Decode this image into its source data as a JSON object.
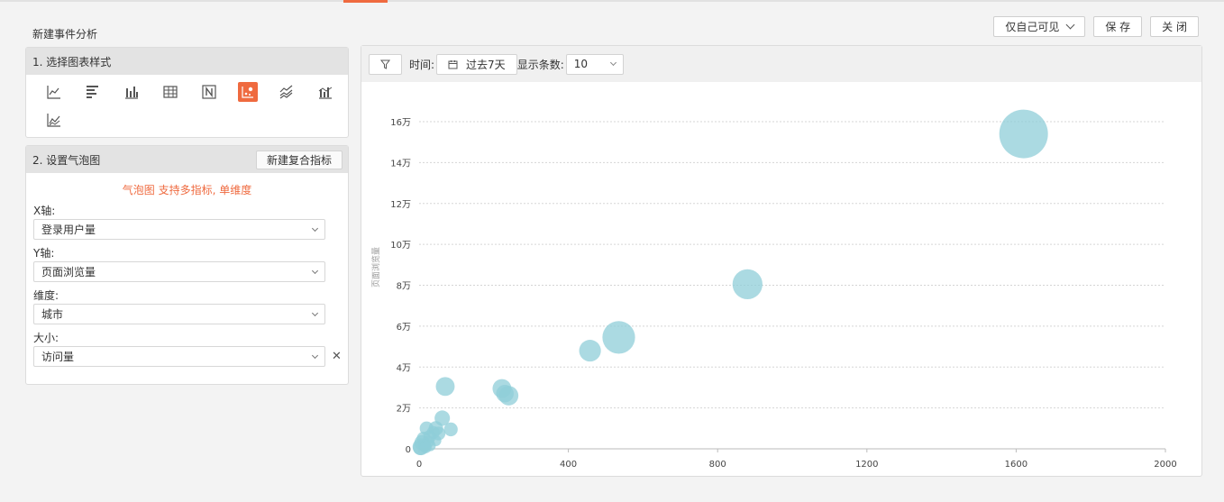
{
  "page": {
    "title": "新建事件分析"
  },
  "top_buttons": {
    "visibility": "仅自己可见",
    "save": "保 存",
    "close": "关 闭"
  },
  "accent_color": "#ef6a3f",
  "section1": {
    "title": "1. 选择图表样式",
    "icons": [
      "line-chart-icon",
      "horizontal-bar-icon",
      "bar-chart-icon",
      "table-icon",
      "number-icon",
      "bubble-chart-icon",
      "stacked-line-icon",
      "stacked-bar-icon",
      "area-line-icon"
    ],
    "active_icon": "bubble-chart-icon"
  },
  "section2": {
    "title": "2. 设置气泡图",
    "new_metric_button": "新建复合指标",
    "note": "气泡图 支持多指标, 单维度",
    "fields": [
      {
        "label": "X轴:",
        "value": "登录用户量"
      },
      {
        "label": "Y轴:",
        "value": "页面浏览量"
      },
      {
        "label": "维度:",
        "value": "城市"
      },
      {
        "label": "大小:",
        "value": "访问量"
      }
    ]
  },
  "toolbar": {
    "time_label": "时间:",
    "time_value": "过去7天",
    "count_label": "显示条数:",
    "count_value": "10"
  },
  "chart_data": {
    "type": "scatter",
    "ylabel": "页面浏览量",
    "x_ticks": [
      "0",
      "400",
      "800",
      "1200",
      "1600",
      "2000"
    ],
    "y_ticks": [
      "0",
      "2万",
      "4万",
      "6万",
      "8万",
      "10万",
      "12万",
      "14万",
      "16万"
    ],
    "xlim": [
      0,
      2000
    ],
    "ylim": [
      0,
      160000
    ],
    "bubble_color": "#8fcdd8",
    "points": [
      {
        "x": 1620,
        "y": 154000,
        "size": 100
      },
      {
        "x": 880,
        "y": 80500,
        "size": 38
      },
      {
        "x": 535,
        "y": 54500,
        "size": 45
      },
      {
        "x": 458,
        "y": 48000,
        "size": 20
      },
      {
        "x": 70,
        "y": 30500,
        "size": 15
      },
      {
        "x": 222,
        "y": 29500,
        "size": 15
      },
      {
        "x": 240,
        "y": 26000,
        "size": 16
      },
      {
        "x": 230,
        "y": 27000,
        "size": 13
      },
      {
        "x": 62,
        "y": 15000,
        "size": 10
      },
      {
        "x": 85,
        "y": 9500,
        "size": 8
      },
      {
        "x": 45,
        "y": 10000,
        "size": 9
      },
      {
        "x": 20,
        "y": 10000,
        "size": 8
      },
      {
        "x": 52,
        "y": 7500,
        "size": 8
      },
      {
        "x": 38,
        "y": 8000,
        "size": 7
      },
      {
        "x": 28,
        "y": 6000,
        "size": 7
      },
      {
        "x": 12,
        "y": 5000,
        "size": 8
      },
      {
        "x": 8,
        "y": 3000,
        "size": 10
      },
      {
        "x": 25,
        "y": 3500,
        "size": 6
      },
      {
        "x": 45,
        "y": 4000,
        "size": 5
      },
      {
        "x": 15,
        "y": 1500,
        "size": 7
      },
      {
        "x": 5,
        "y": 1000,
        "size": 12
      },
      {
        "x": 3,
        "y": 500,
        "size": 9
      },
      {
        "x": 30,
        "y": 1500,
        "size": 5
      },
      {
        "x": 18,
        "y": 800,
        "size": 6
      }
    ]
  }
}
